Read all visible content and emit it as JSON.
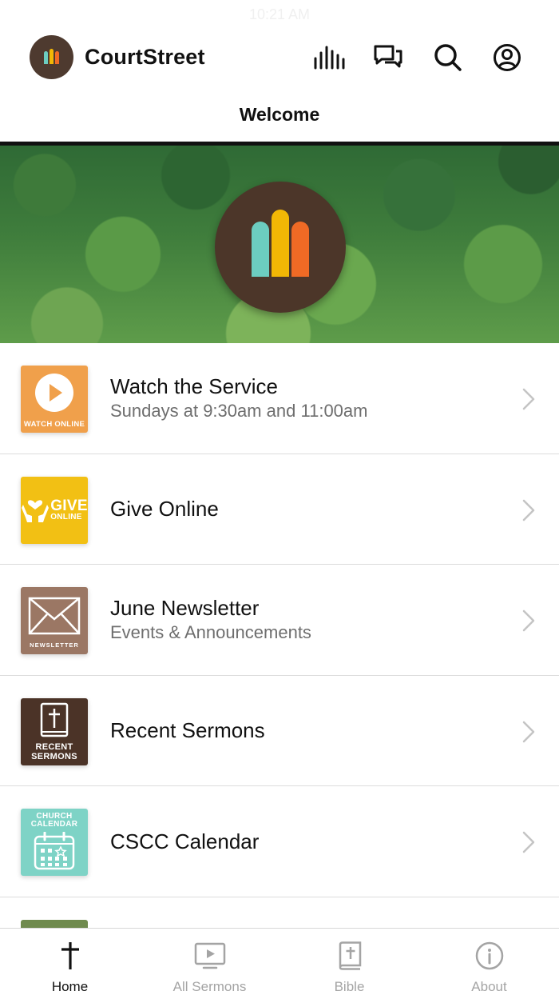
{
  "status": {
    "time": "10:21 AM"
  },
  "app": {
    "name": "CourtStreet",
    "logo_colors": [
      "#6ccdc0",
      "#f2b705",
      "#ef6a25"
    ]
  },
  "header": {
    "icons": [
      "audio-bars-icon",
      "chat-icon",
      "search-icon",
      "account-icon"
    ],
    "page_title": "Welcome"
  },
  "hero": {
    "logo_colors": [
      "#6ccdc0",
      "#f2b705",
      "#ef6a25"
    ]
  },
  "menu": {
    "items": [
      {
        "title": "Watch the Service",
        "subtitle": "Sundays at 9:30am and 11:00am",
        "thumb_caption": "WATCH ONLINE",
        "thumb_color": "#f0a04b",
        "icon": "play-icon"
      },
      {
        "title": "Give Online",
        "subtitle": "",
        "thumb_caption": "GIVE",
        "thumb_caption_small": "ONLINE",
        "thumb_color": "#f2c014",
        "icon": "hands-heart-icon"
      },
      {
        "title": "June Newsletter",
        "subtitle": "Events & Announcements",
        "thumb_caption": "NEWSLETTER",
        "thumb_color": "#9b7764",
        "icon": "envelope-icon"
      },
      {
        "title": "Recent Sermons",
        "subtitle": "",
        "thumb_caption": "RECENT SERMONS",
        "thumb_color": "#4b3327",
        "icon": "bible-icon"
      },
      {
        "title": "CSCC Calendar",
        "subtitle": "",
        "thumb_caption": "CHURCH CALENDAR",
        "thumb_color": "#7ed3c6",
        "icon": "calendar-icon"
      }
    ]
  },
  "tabs": [
    {
      "label": "Home",
      "icon": "cross-icon",
      "active": true
    },
    {
      "label": "All Sermons",
      "icon": "tv-play-icon",
      "active": false
    },
    {
      "label": "Bible",
      "icon": "bible-book-icon",
      "active": false
    },
    {
      "label": "About",
      "icon": "info-icon",
      "active": false
    }
  ]
}
